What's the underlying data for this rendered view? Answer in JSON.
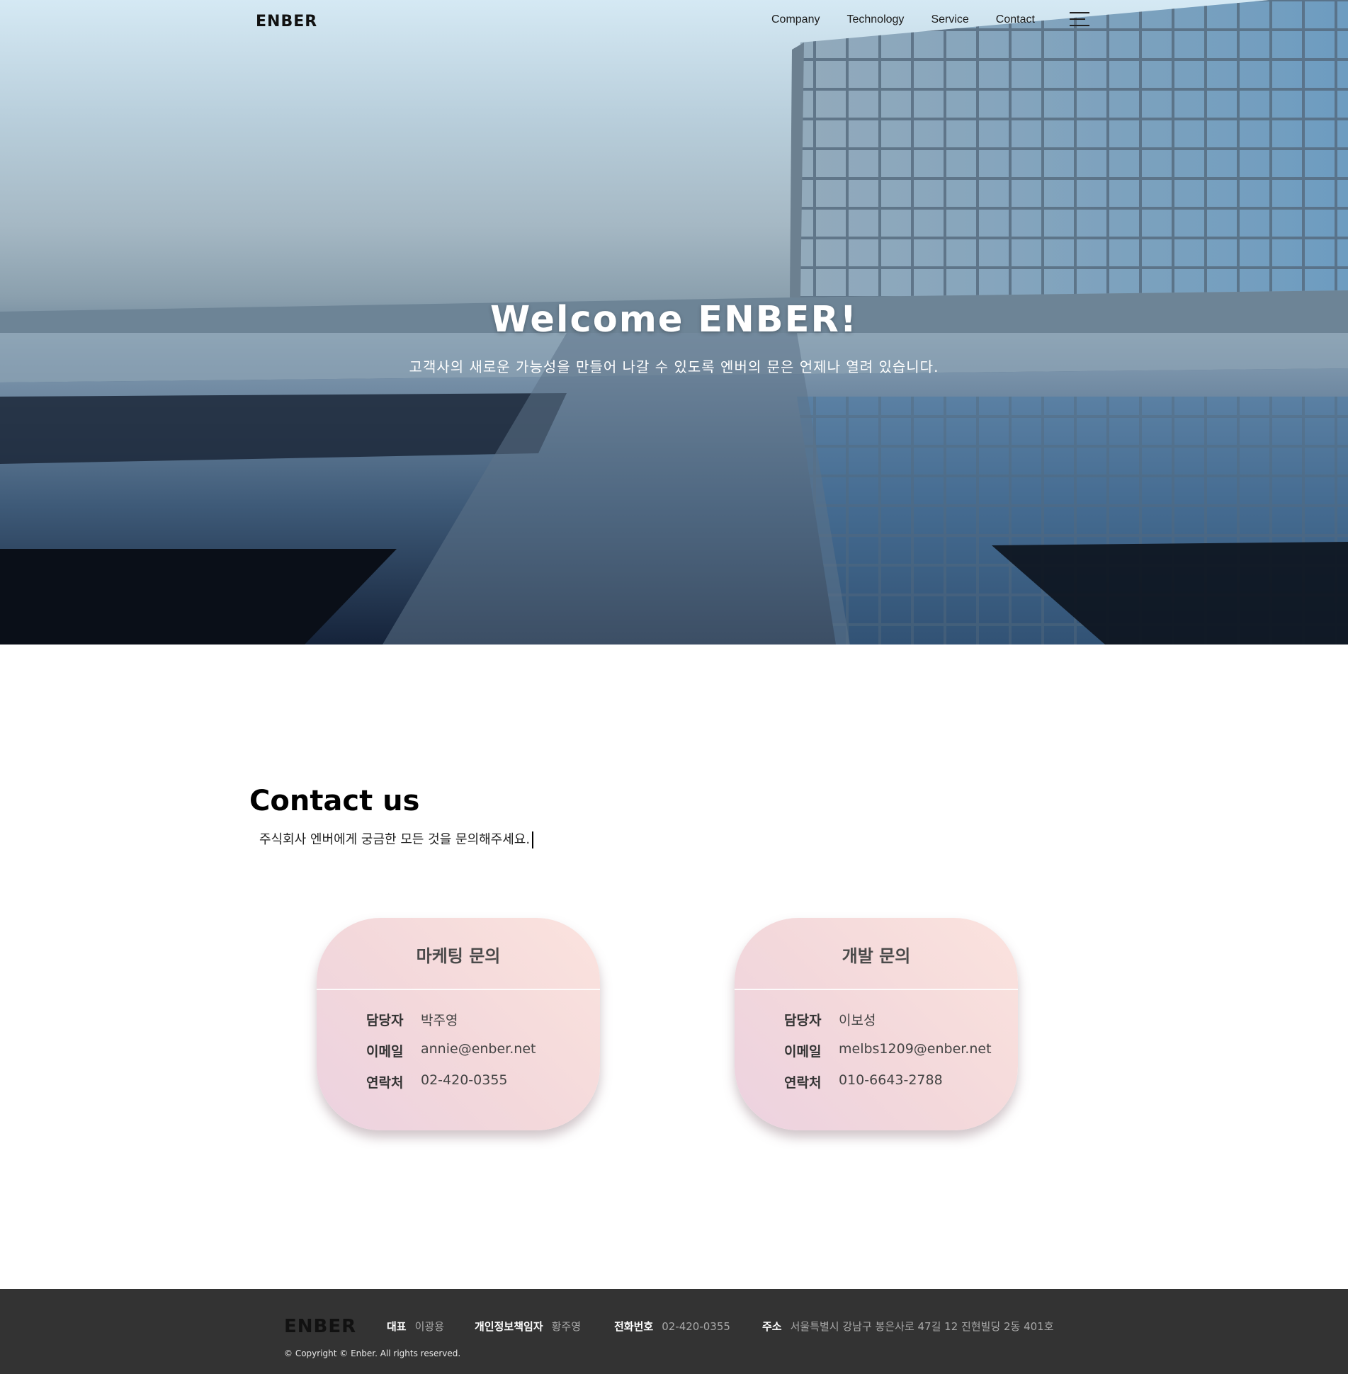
{
  "header": {
    "logo": "ENBER",
    "nav": [
      "Company",
      "Technology",
      "Service",
      "Contact"
    ],
    "menu_icon": "hamburger-icon"
  },
  "hero": {
    "title": "Welcome ENBER!",
    "subtitle": "고객사의 새로운 가능성을 만들어 나갈 수 있도록 엔버의 문은 언제나 열려 있습니다."
  },
  "contact": {
    "title": "Contact us",
    "subtitle": "주식회사 엔버에게 궁금한 모든 것을 문의해주세요.",
    "cards": [
      {
        "title": "마케팅 문의",
        "rows": [
          {
            "label": "담당자",
            "value": "박주영"
          },
          {
            "label": "이메일",
            "value": "annie@enber.net"
          },
          {
            "label": "연락처",
            "value": "02-420-0355"
          }
        ]
      },
      {
        "title": "개발 문의",
        "rows": [
          {
            "label": "담당자",
            "value": "이보성"
          },
          {
            "label": "이메일",
            "value": "melbs1209@enber.net"
          },
          {
            "label": "연락처",
            "value": "010-6643-2788"
          }
        ]
      }
    ]
  },
  "footer": {
    "logo": "ENBER",
    "info": [
      {
        "key": "대표",
        "value": "이광용"
      },
      {
        "key": "개인정보책임자",
        "value": "황주영"
      },
      {
        "key": "전화번호",
        "value": "02-420-0355"
      },
      {
        "key": "주소",
        "value": "서울특별시 강남구 봉은사로 47길 12 진현빌딩 2동 401호"
      }
    ],
    "copyright": "© Copyright © Enber. All rights reserved."
  },
  "colors": {
    "footer_bg": "#333333",
    "card_gradient_start": "#fbe3de",
    "card_gradient_end": "#ecd2e0"
  }
}
